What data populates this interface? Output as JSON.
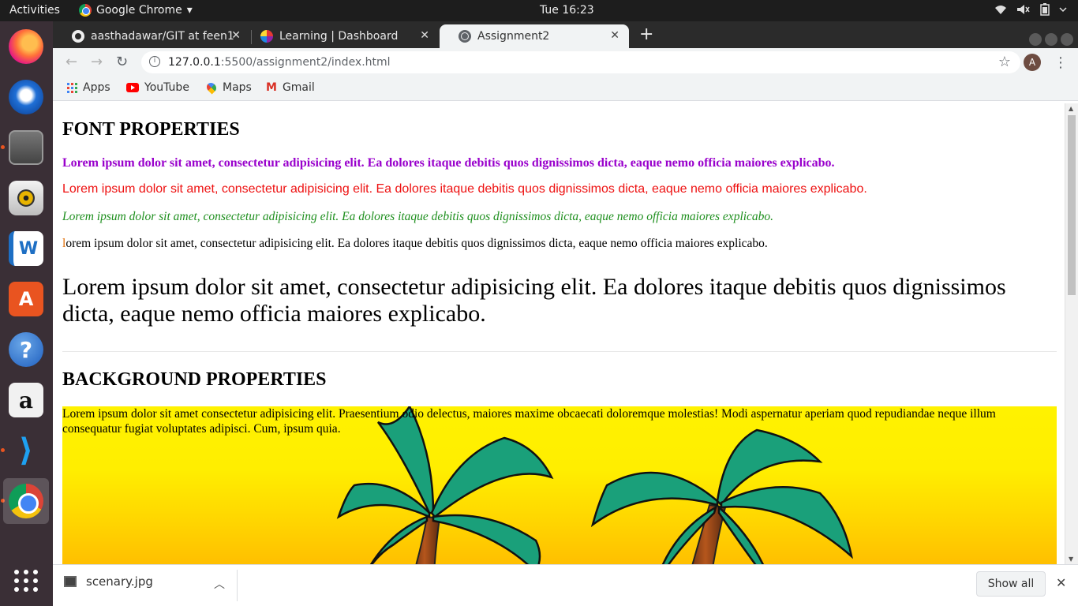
{
  "topbar": {
    "activities": "Activities",
    "app_name": "Google Chrome",
    "app_caret": "▾",
    "clock": "Tue 16:23",
    "tray": [
      "wifi-icon",
      "volume-icon",
      "battery-icon"
    ]
  },
  "dock": {
    "items": [
      {
        "name": "firefox",
        "icon": "firefox-icon"
      },
      {
        "name": "thunderbird",
        "icon": "thunderbird-icon"
      },
      {
        "name": "files",
        "icon": "files-icon"
      },
      {
        "name": "rhythmbox",
        "icon": "rhythmbox-icon"
      },
      {
        "name": "libreoffice-writer",
        "icon": "writer-icon"
      },
      {
        "name": "software",
        "icon": "appstore-icon"
      },
      {
        "name": "help",
        "icon": "help-icon"
      },
      {
        "name": "amazon",
        "icon": "amazon-icon"
      },
      {
        "name": "vscode",
        "icon": "vscode-icon"
      },
      {
        "name": "chrome",
        "icon": "chrome-icon"
      },
      {
        "name": "show-applications",
        "icon": "app-grid-icon"
      }
    ],
    "glyphs": {
      "help": "?",
      "amazon": "a",
      "vscode": "⟩",
      "appstore": "A",
      "writer": "W"
    }
  },
  "browser": {
    "tabs": [
      {
        "title": "aasthadawar/GIT at feen1",
        "icon": "github-icon",
        "active": false
      },
      {
        "title": "Learning | Dashboard",
        "icon": "learning-icon",
        "active": false
      },
      {
        "title": "Assignment2",
        "icon": "globe-icon",
        "active": true
      }
    ],
    "tab_close": "✕",
    "new_tab": "+",
    "nav": {
      "back": "←",
      "forward": "→",
      "reload": "↻"
    },
    "url_host": "127.0.0.1",
    "url_path": ":5500/assignment2/index.html",
    "star": "☆",
    "avatar_letter": "A",
    "menu": "⋮",
    "bookmarks": [
      {
        "label": "Apps",
        "icon": "apps-icon"
      },
      {
        "label": "YouTube",
        "icon": "youtube-icon"
      },
      {
        "label": "Maps",
        "icon": "maps-icon"
      },
      {
        "label": "Gmail",
        "icon": "gmail-icon"
      }
    ],
    "gmail_glyph": "M"
  },
  "page": {
    "font_heading": "FONT PROPERTIES",
    "para_bold_purple": "Lorem ipsum dolor sit amet, consectetur adipisicing elit. Ea dolores itaque debitis quos dignissimos dicta, eaque nemo officia maiores explicabo.",
    "para_red_sans": "Lorem ipsum dolor sit amet, consectetur adipisicing elit. Ea dolores itaque debitis quos dignissimos dicta, eaque nemo officia maiores explicabo.",
    "para_italic_green": "Lorem ipsum dolor sit amet, consectetur adipisicing elit. Ea dolores itaque debitis quos dignissimos dicta, eaque nemo officia maiores explicabo.",
    "para_first_letter": "l",
    "para_lowercase_rest": "orem ipsum dolor sit amet, consectetur adipisicing elit. Ea dolores itaque debitis quos dignissimos dicta, eaque nemo officia maiores explicabo.",
    "para_large": "Lorem ipsum dolor sit amet, consectetur adipisicing elit. Ea dolores itaque debitis quos dignissimos dicta, eaque nemo officia maiores explicabo.",
    "background_heading": "BACKGROUND PROPERTIES",
    "background_text": "Lorem ipsum dolor sit amet consectetur adipisicing elit. Praesentium odio delectus, maiores maxime obcaecati doloremque molestias! Modi aspernatur aperiam quod repudiandae neque illum consequatur fugiat voluptates adipisci. Cum, ipsum quia.",
    "colors": {
      "purple": "#9900cc",
      "red": "#ee1111",
      "green": "#1e8f1e",
      "first_letter": "#e06a00"
    }
  },
  "downloads": {
    "file_name": "scenary.jpg",
    "chevron": "︿",
    "show_all": "Show all",
    "close": "✕"
  }
}
